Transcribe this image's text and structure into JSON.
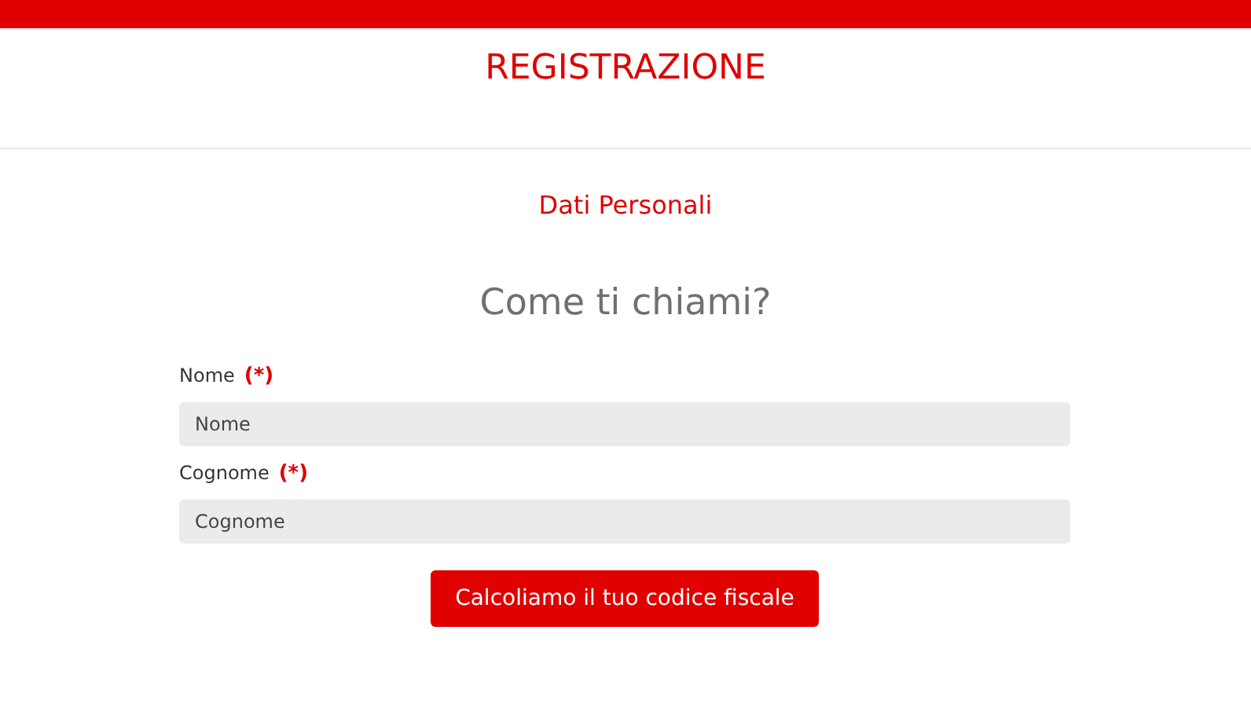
{
  "header": {
    "title": "REGISTRAZIONE"
  },
  "section": {
    "title": "Dati Personali"
  },
  "question": "Come ti chiami?",
  "fields": [
    {
      "label": "Nome",
      "required_mark": "(*)",
      "placeholder": "Nome"
    },
    {
      "label": "Cognome",
      "required_mark": "(*)",
      "placeholder": "Cognome"
    }
  ],
  "submit_button": "Calcoliamo il tuo codice fiscale"
}
